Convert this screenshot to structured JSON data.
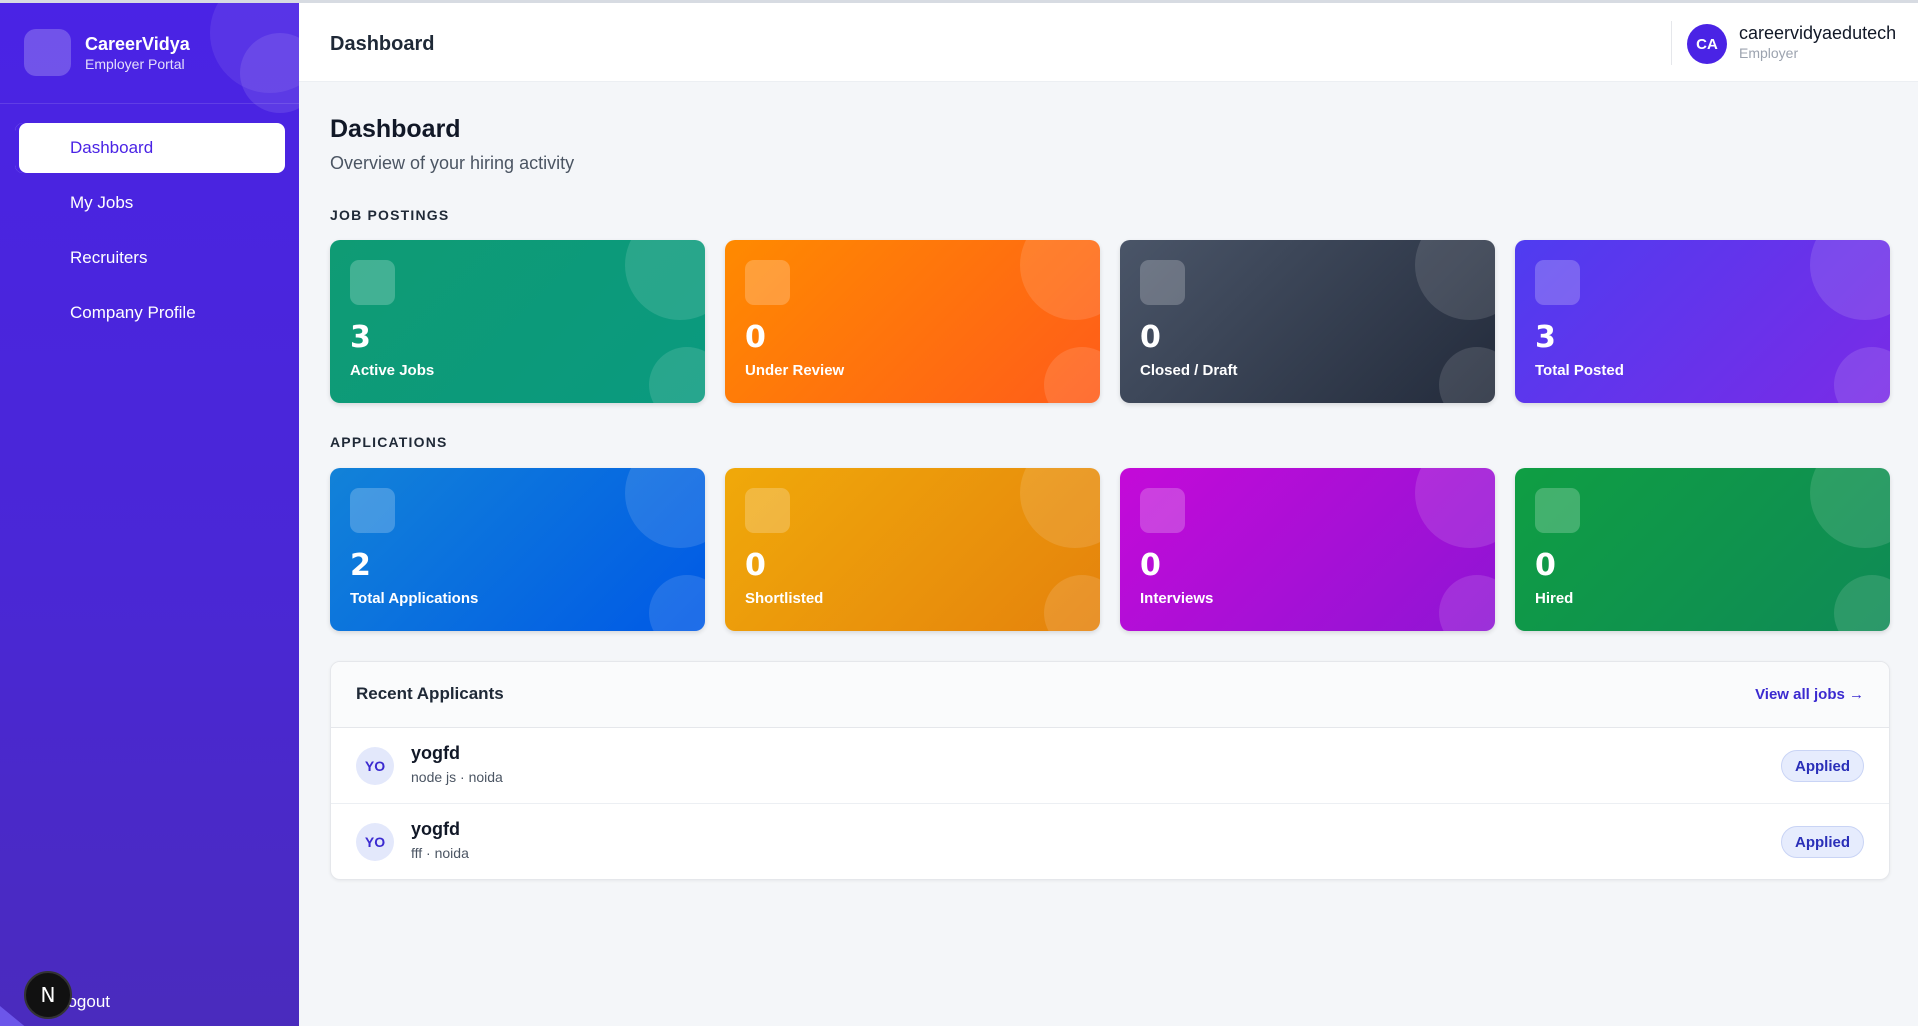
{
  "brand": {
    "name": "CareerVidya",
    "subtitle": "Employer Portal"
  },
  "sidebar": {
    "items": [
      {
        "label": "Dashboard",
        "active": true
      },
      {
        "label": "My Jobs",
        "active": false
      },
      {
        "label": "Recruiters",
        "active": false
      },
      {
        "label": "Company Profile",
        "active": false
      }
    ],
    "logout_label": "Logout",
    "dev_badge": "N"
  },
  "header": {
    "title": "Dashboard",
    "user": {
      "initials": "CA",
      "name": "careervidyaedutech",
      "role": "Employer"
    }
  },
  "page": {
    "title": "Dashboard",
    "subtitle": "Overview of your hiring activity"
  },
  "job_postings": {
    "label": "JOB POSTINGS",
    "cards": [
      {
        "value": "3",
        "label": "Active Jobs",
        "color": "#0f9b74"
      },
      {
        "value": "0",
        "label": "Under Review",
        "color": "#ff7a0d"
      },
      {
        "value": "0",
        "label": "Closed / Draft",
        "color": "#374151"
      },
      {
        "value": "3",
        "label": "Total Posted",
        "color": "#5b35ec"
      }
    ]
  },
  "applications": {
    "label": "APPLICATIONS",
    "cards": [
      {
        "value": "2",
        "label": "Total Applications",
        "color": "#0a6fe0"
      },
      {
        "value": "0",
        "label": "Shortlisted",
        "color": "#eb9a0c"
      },
      {
        "value": "0",
        "label": "Interviews",
        "color": "#a810d6"
      },
      {
        "value": "0",
        "label": "Hired",
        "color": "#0f954b"
      }
    ]
  },
  "recent_applicants": {
    "title": "Recent Applicants",
    "view_all_label": "View all jobs →",
    "rows": [
      {
        "initials": "YO",
        "name": "yogfd",
        "meta": "node js · noida",
        "status": "Applied"
      },
      {
        "initials": "YO",
        "name": "yogfd",
        "meta": "fff · noida",
        "status": "Applied"
      }
    ]
  }
}
